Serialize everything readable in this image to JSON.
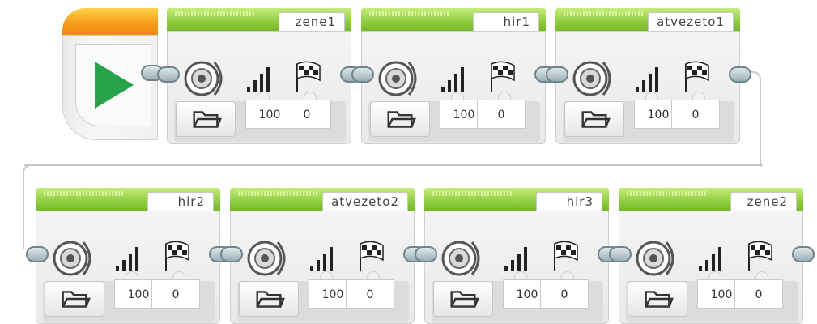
{
  "program": {
    "start_label": "",
    "rows": [
      {
        "blocks": [
          {
            "name": "zene1",
            "volume": "100",
            "play_type": "0"
          },
          {
            "name": "hir1",
            "volume": "100",
            "play_type": "0"
          },
          {
            "name": "atvezeto1",
            "volume": "100",
            "play_type": "0"
          }
        ]
      },
      {
        "blocks": [
          {
            "name": "hir2",
            "volume": "100",
            "play_type": "0"
          },
          {
            "name": "atvezeto2",
            "volume": "100",
            "play_type": "0"
          },
          {
            "name": "hir3",
            "volume": "100",
            "play_type": "0"
          },
          {
            "name": "zene2",
            "volume": "100",
            "play_type": "0"
          }
        ]
      }
    ],
    "icons": {
      "start": "play-icon",
      "sound": "speaker-icon",
      "volume": "volume-bars-icon",
      "play_type": "checkered-flag-icon",
      "file": "folder-icon"
    },
    "colors": {
      "start_accent": "#f59a17",
      "play_green": "#28a349",
      "block_header_green": "#88c83a"
    }
  }
}
